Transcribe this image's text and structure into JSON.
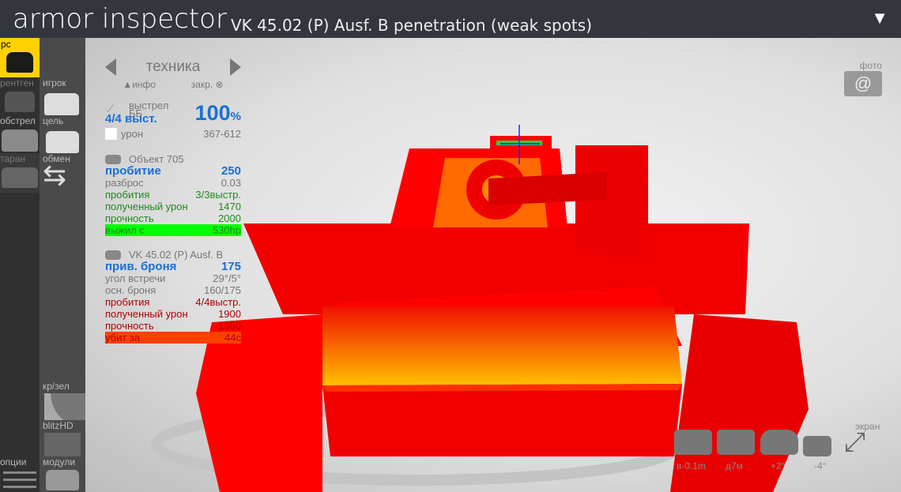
{
  "title": {
    "app": "armor inspector",
    "subtitle": "VK 45.02 (P) Ausf. B penetration (weak spots)",
    "menu_icon": "triangle-down"
  },
  "sidebar": {
    "col1": [
      {
        "label": "рс",
        "active": true
      },
      {
        "label": "рентген"
      },
      {
        "label": "обстрел"
      },
      {
        "label": "таран"
      },
      {
        "label": "опции"
      }
    ],
    "col2": [
      {
        "label": "игрок"
      },
      {
        "label": "цель"
      },
      {
        "label": "обмен"
      },
      {
        "label": "кр/зел"
      },
      {
        "label": "blitzHD"
      },
      {
        "label": "модули"
      }
    ],
    "active_color": "#ffd200"
  },
  "panel": {
    "nav": {
      "title": "техника",
      "info": "▲инфо",
      "close": "закр."
    },
    "shot": {
      "label": "выстрел",
      "ammo": "ББ",
      "shots": "4/4 выст.",
      "percent": "100",
      "percent_sign": "%",
      "damage_label": "урон",
      "damage": "367-612"
    },
    "attacker": {
      "name": "Объект 705",
      "pen_label": "пробитие",
      "pen": "250",
      "spread_label": "разброс",
      "spread": "0.03",
      "pens_label": "пробития",
      "pens": "3/3выстр.",
      "dmg_label": "полученный урон",
      "dmg": "1470",
      "hp_label": "прочность",
      "hp": "2000",
      "result_label": "выжил с",
      "result": "530hp",
      "result_color": "#00ff00"
    },
    "target": {
      "name": "VK 45.02 (P) Ausf. B",
      "armor_label": "прив. броня",
      "armor": "175",
      "angle_label": "угол встречи",
      "angle": "29°/5°",
      "base_label": "осн. броня",
      "base": "160/175",
      "pens_label": "пробития",
      "pens": "4/4выстр.",
      "dmg_label": "полученный урон",
      "dmg": "1900",
      "hp_label": "прочность",
      "hp": "1350",
      "result_label": "убит за",
      "result": "44с",
      "result_color": "#ff4000"
    }
  },
  "photo": {
    "label": "фото"
  },
  "controls": {
    "screen_label": "экран",
    "height": "в-0.1m",
    "distance": "д7м",
    "tilt": "+2°",
    "turret": "-4°"
  }
}
